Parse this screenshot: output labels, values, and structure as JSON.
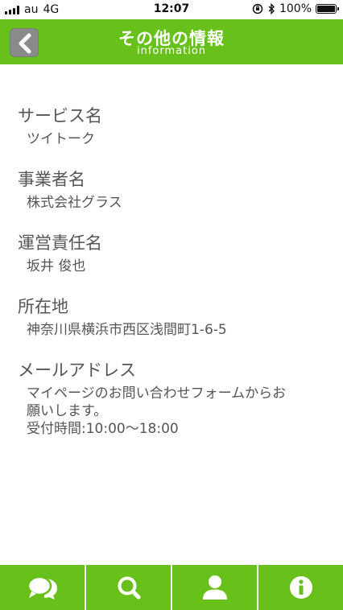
{
  "status_bar": {
    "carrier": "au",
    "network": "4G",
    "time": "12:07",
    "battery": "100%"
  },
  "header": {
    "title": "その他の情報",
    "subtitle": "information",
    "back_icon": "chevron-left-icon"
  },
  "sections": [
    {
      "title": "サービス名",
      "lines": [
        "ツイトーク"
      ]
    },
    {
      "title": "事業者名",
      "lines": [
        "株式会社グラス"
      ]
    },
    {
      "title": "運営責任名",
      "lines": [
        "坂井 俊也"
      ]
    },
    {
      "title": "所在地",
      "lines": [
        "神奈川県横浜市西区浅間町1-6-5"
      ]
    },
    {
      "title": "メールアドレス",
      "lines": [
        "マイページのお問い合わせフォームからお",
        "願いします。",
        "受付時間:10:00〜18:00"
      ]
    }
  ],
  "tabbar": {
    "tabs": [
      {
        "icon": "chat-bubbles-icon"
      },
      {
        "icon": "search-icon"
      },
      {
        "icon": "user-icon"
      },
      {
        "icon": "info-icon"
      }
    ]
  },
  "colors": {
    "brand_green": "#67c11a",
    "back_button_gray": "#8a8a8a",
    "text": "#555555"
  }
}
